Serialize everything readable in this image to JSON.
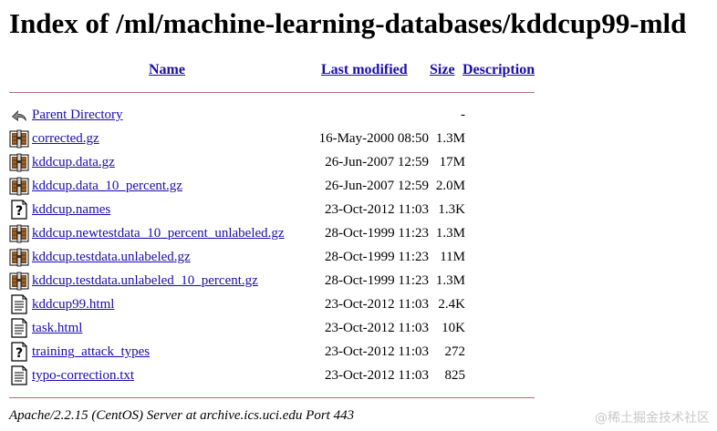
{
  "page": {
    "title": "Index of /ml/machine-learning-databases/kddcup99-mld",
    "columns": {
      "name": "Name",
      "last_modified": "Last modified",
      "size": "Size",
      "description": "Description"
    },
    "rows": [
      {
        "icon": "back-icon",
        "name": "Parent Directory",
        "modified": "",
        "size": "-"
      },
      {
        "icon": "compressed-icon",
        "name": "corrected.gz",
        "modified": "16-May-2000 08:50",
        "size": "1.3M"
      },
      {
        "icon": "compressed-icon",
        "name": "kddcup.data.gz",
        "modified": "26-Jun-2007 12:59",
        "size": "17M"
      },
      {
        "icon": "compressed-icon",
        "name": "kddcup.data_10_percent.gz",
        "modified": "26-Jun-2007 12:59",
        "size": "2.0M"
      },
      {
        "icon": "unknown-icon",
        "name": "kddcup.names",
        "modified": "23-Oct-2012 11:03",
        "size": "1.3K"
      },
      {
        "icon": "compressed-icon",
        "name": "kddcup.newtestdata_10_percent_unlabeled.gz",
        "modified": "28-Oct-1999 11:23",
        "size": "1.3M"
      },
      {
        "icon": "compressed-icon",
        "name": "kddcup.testdata.unlabeled.gz",
        "modified": "28-Oct-1999 11:23",
        "size": "11M"
      },
      {
        "icon": "compressed-icon",
        "name": "kddcup.testdata.unlabeled_10_percent.gz",
        "modified": "28-Oct-1999 11:23",
        "size": "1.3M"
      },
      {
        "icon": "text-file-icon",
        "name": "kddcup99.html",
        "modified": "23-Oct-2012 11:03",
        "size": "2.4K"
      },
      {
        "icon": "text-file-icon",
        "name": "task.html",
        "modified": "23-Oct-2012 11:03",
        "size": "10K"
      },
      {
        "icon": "unknown-icon",
        "name": "training_attack_types",
        "modified": "23-Oct-2012 11:03",
        "size": "272"
      },
      {
        "icon": "text-file-icon",
        "name": "typo-correction.txt",
        "modified": "23-Oct-2012 11:03",
        "size": "825"
      }
    ],
    "footer": "Apache/2.2.15 (CentOS) Server at archive.ics.uci.edu Port 443",
    "watermark": "@稀土掘金技术社区"
  }
}
